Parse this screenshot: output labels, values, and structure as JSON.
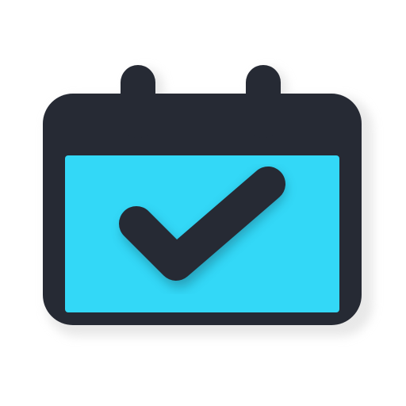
{
  "icon": {
    "name": "calendar-check-icon",
    "colors": {
      "body": "#262a34",
      "screen": "#33d8f7",
      "check": "#262a34",
      "shadow": "#d9d9d9",
      "background": "#ffffff"
    }
  }
}
